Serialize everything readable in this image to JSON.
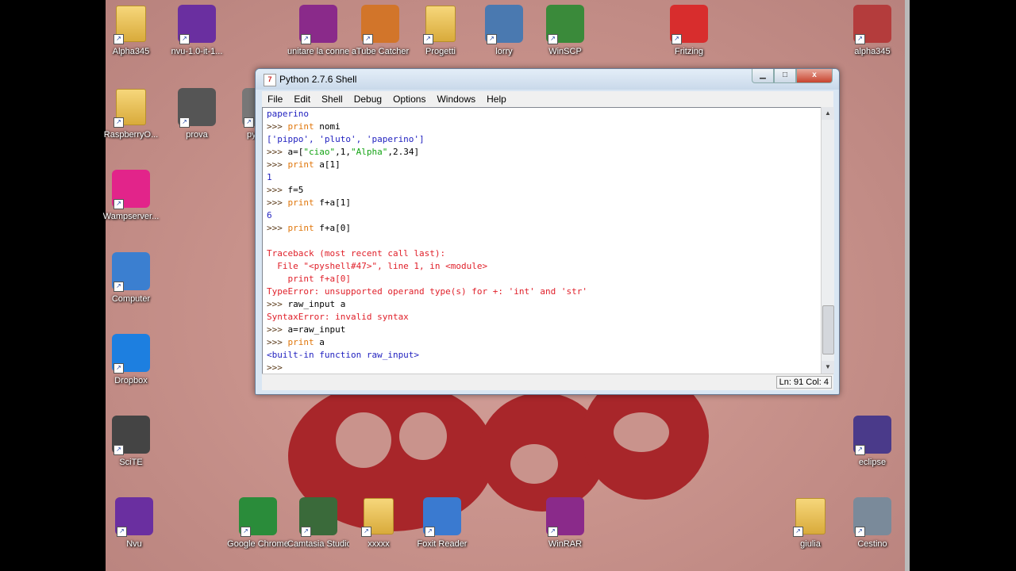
{
  "desktop_icons": [
    {
      "label": "Alpha345",
      "icon": "user-folder-icon",
      "color": "#e2b64a"
    },
    {
      "label": "nvu-1.0-it-1...",
      "icon": "nvu-icon",
      "color": "#6a2fa0"
    },
    {
      "label": "unitare la connessio...",
      "icon": "winrar-icon",
      "color": "#8a2a8a"
    },
    {
      "label": "aTube Catcher",
      "icon": "atube-catcher-icon",
      "color": "#d2752a"
    },
    {
      "label": "Progetti",
      "icon": "folder-icon",
      "color": "#e2b64a"
    },
    {
      "label": "lorry",
      "icon": "network-computer-icon",
      "color": "#4a79b0"
    },
    {
      "label": "WinSCP",
      "icon": "winscp-icon",
      "color": "#3a8a3a"
    },
    {
      "label": "Fritzing",
      "icon": "fritzing-icon",
      "color": "#d82d2d"
    },
    {
      "label": "alpha345",
      "icon": "fritzing-file-icon",
      "color": "#b43c3c"
    },
    {
      "label": "RaspberryO...",
      "icon": "folder-icon",
      "color": "#e2b64a"
    },
    {
      "label": "prova",
      "icon": "file-icon",
      "color": "#555555"
    },
    {
      "label": "pytho...",
      "icon": "python-file-icon",
      "color": "#777777"
    },
    {
      "label": "Wampserver...",
      "icon": "wampserver-icon",
      "color": "#e2248a"
    },
    {
      "label": "Computer",
      "icon": "computer-icon",
      "color": "#3b7fd0"
    },
    {
      "label": "Dropbox",
      "icon": "dropbox-icon",
      "color": "#1d7fe0"
    },
    {
      "label": "SciTE",
      "icon": "scite-icon",
      "color": "#444444"
    },
    {
      "label": "Nvu",
      "icon": "nvu-icon",
      "color": "#6a2fa0"
    },
    {
      "label": "Google Chrome",
      "icon": "chrome-icon",
      "color": "#2a8c3a"
    },
    {
      "label": "Camtasia Studio 8",
      "icon": "camtasia-icon",
      "color": "#3a6a3a"
    },
    {
      "label": "xxxxx",
      "icon": "folder-icon",
      "color": "#e2b64a"
    },
    {
      "label": "Foxit Reader",
      "icon": "foxit-reader-icon",
      "color": "#3a7ad0"
    },
    {
      "label": "WinRAR",
      "icon": "winrar-icon",
      "color": "#8a2a8a"
    },
    {
      "label": "giulia",
      "icon": "folder-icon",
      "color": "#e2b64a"
    },
    {
      "label": "Cestino",
      "icon": "recycle-bin-icon",
      "color": "#7a8a9a"
    },
    {
      "label": "eclipse",
      "icon": "eclipse-icon",
      "color": "#4a3a8a"
    }
  ],
  "window": {
    "title": "Python 2.7.6 Shell",
    "menu": [
      "File",
      "Edit",
      "Shell",
      "Debug",
      "Options",
      "Windows",
      "Help"
    ],
    "buttons": {
      "minimize": "▁",
      "maximize": "□",
      "close": "x"
    },
    "status": "Ln: 91  Col: 4"
  },
  "shell_lines": [
    [
      {
        "c": "out",
        "t": "paperino"
      }
    ],
    [
      {
        "c": "prompt",
        "t": ">>> "
      },
      {
        "c": "kw",
        "t": "print"
      },
      {
        "c": "code",
        "t": " nomi"
      }
    ],
    [
      {
        "c": "out",
        "t": "['pippo', 'pluto', 'paperino']"
      }
    ],
    [
      {
        "c": "prompt",
        "t": ">>> "
      },
      {
        "c": "code",
        "t": "a=["
      },
      {
        "c": "str",
        "t": "\"ciao\""
      },
      {
        "c": "code",
        "t": ",1,"
      },
      {
        "c": "str",
        "t": "\"Alpha\""
      },
      {
        "c": "code",
        "t": ",2.34]"
      }
    ],
    [
      {
        "c": "prompt",
        "t": ">>> "
      },
      {
        "c": "kw",
        "t": "print"
      },
      {
        "c": "code",
        "t": " a[1]"
      }
    ],
    [
      {
        "c": "out",
        "t": "1"
      }
    ],
    [
      {
        "c": "prompt",
        "t": ">>> "
      },
      {
        "c": "code",
        "t": "f=5"
      }
    ],
    [
      {
        "c": "prompt",
        "t": ">>> "
      },
      {
        "c": "kw",
        "t": "print"
      },
      {
        "c": "code",
        "t": " f+a[1]"
      }
    ],
    [
      {
        "c": "out",
        "t": "6"
      }
    ],
    [
      {
        "c": "prompt",
        "t": ">>> "
      },
      {
        "c": "kw",
        "t": "print"
      },
      {
        "c": "code",
        "t": " f+a[0]"
      }
    ],
    [
      {
        "c": "out",
        "t": ""
      }
    ],
    [
      {
        "c": "err",
        "t": "Traceback (most recent call last):"
      }
    ],
    [
      {
        "c": "err",
        "t": "  File \"<pyshell#47>\", line 1, in <module>"
      }
    ],
    [
      {
        "c": "err",
        "t": "    print f+a[0]"
      }
    ],
    [
      {
        "c": "err",
        "t": "TypeError: unsupported operand type(s) for +: 'int' and 'str'"
      }
    ],
    [
      {
        "c": "prompt",
        "t": ">>> "
      },
      {
        "c": "code",
        "t": "raw_input a"
      }
    ],
    [
      {
        "c": "err",
        "t": "SyntaxError: invalid syntax"
      }
    ],
    [
      {
        "c": "prompt",
        "t": ">>> "
      },
      {
        "c": "code",
        "t": "a=raw_input"
      }
    ],
    [
      {
        "c": "prompt",
        "t": ">>> "
      },
      {
        "c": "kw",
        "t": "print"
      },
      {
        "c": "code",
        "t": " a"
      }
    ],
    [
      {
        "c": "out",
        "t": "<built-in function raw_input>"
      }
    ],
    [
      {
        "c": "prompt",
        "t": ">>> "
      }
    ]
  ]
}
